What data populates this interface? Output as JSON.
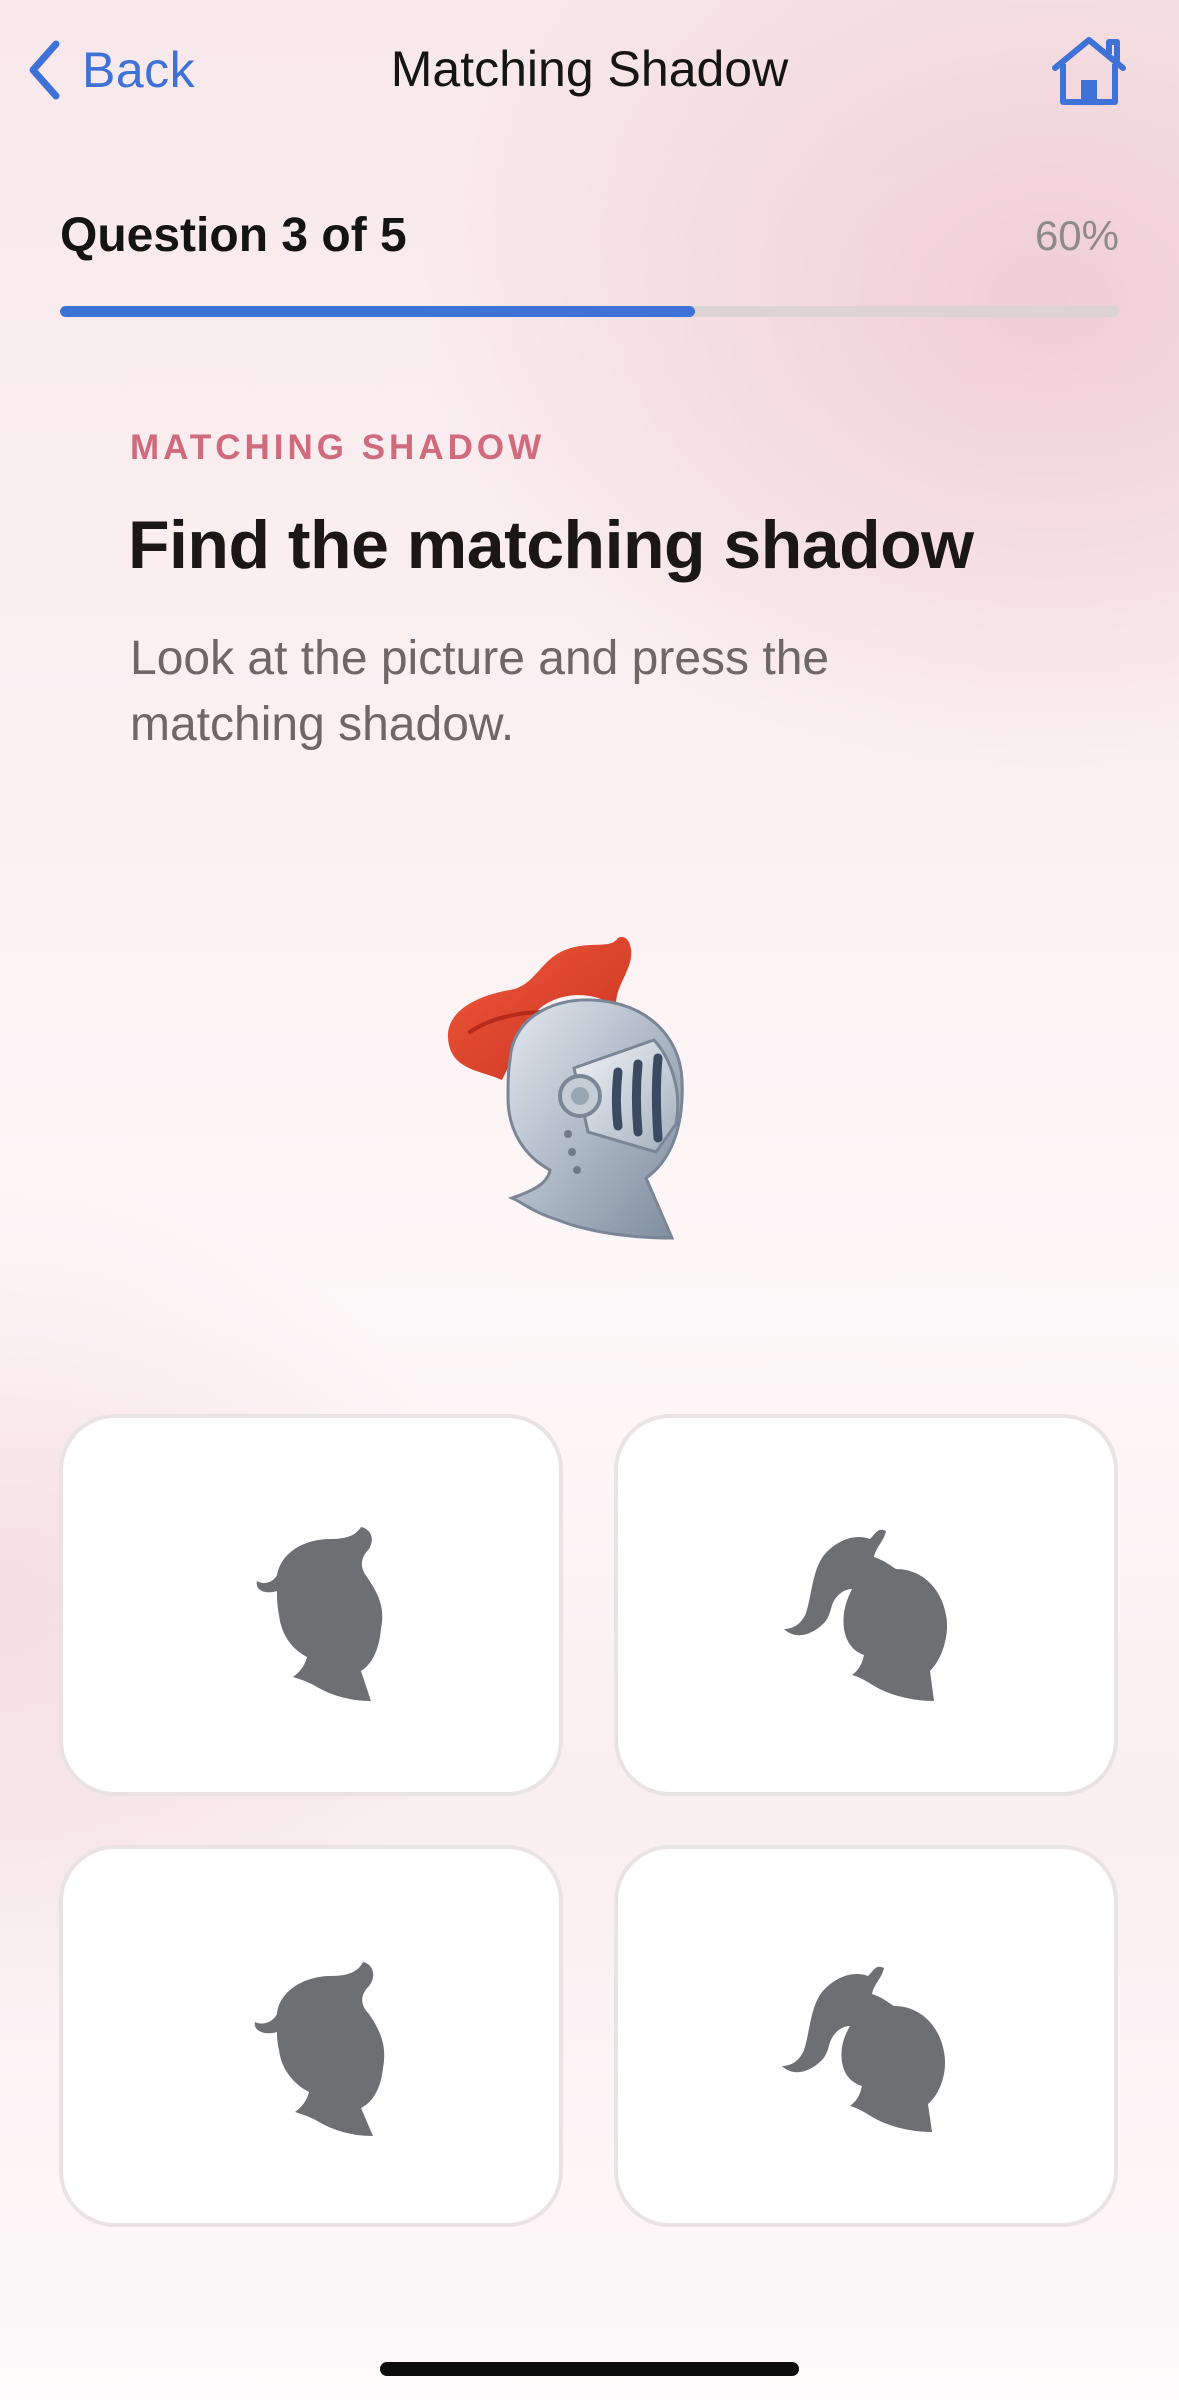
{
  "nav": {
    "back_label": "Back",
    "title": "Matching Shadow",
    "back_icon": "chevron-left-icon",
    "home_icon": "home-icon"
  },
  "progress": {
    "question_label": "Question 3 of 5",
    "percent_label": "60%",
    "fraction": 0.6
  },
  "question": {
    "eyebrow": "MATCHING SHADOW",
    "title": "Find the matching shadow",
    "instruction": "Look at the picture and press the matching shadow.",
    "picture_icon": "knight-helmet-icon"
  },
  "answers": [
    {
      "icon": "helmet-short-plume-silhouette-icon"
    },
    {
      "icon": "helmet-long-plume-silhouette-icon"
    },
    {
      "icon": "helmet-short-plume-silhouette-icon"
    },
    {
      "icon": "helmet-long-plume-silhouette-icon"
    }
  ],
  "colors": {
    "accent": "#3f72d6",
    "eyebrow": "#d06a7d",
    "silhouette": "#6e6f73",
    "plume": "#e0442c"
  }
}
